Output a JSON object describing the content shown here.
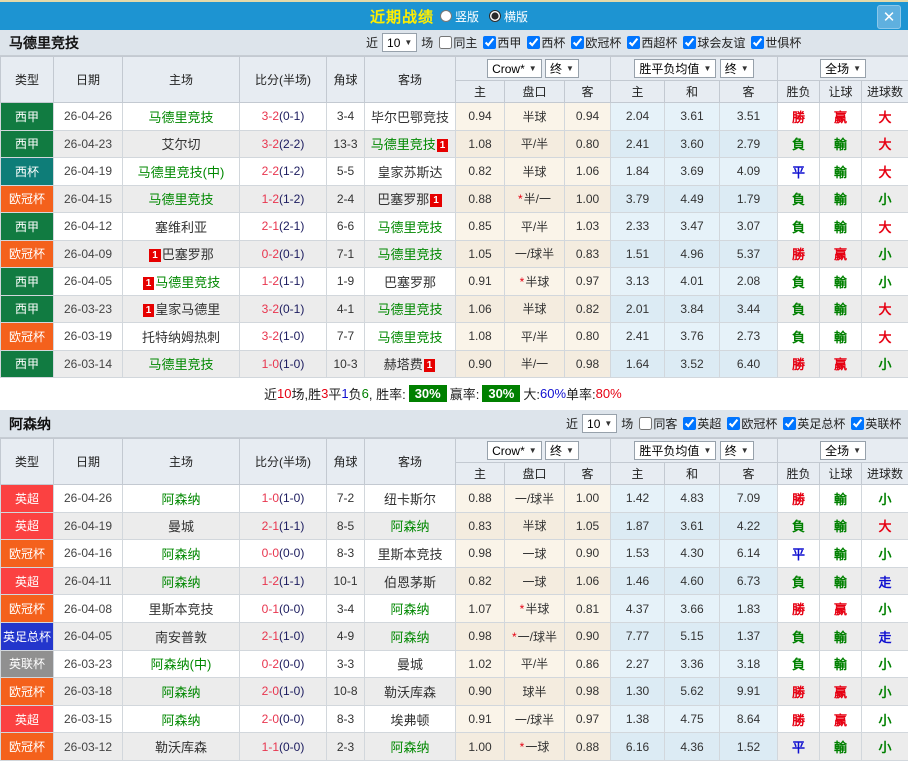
{
  "topbar": {
    "title": "近期战绩",
    "radios": [
      {
        "label": "竖版",
        "selected": false
      },
      {
        "label": "横版",
        "selected": true
      }
    ],
    "close_icon": "✕",
    "bar_color": "#1d94d2"
  },
  "dropdown_arrow": "▼",
  "table_header": {
    "cols": [
      "类型",
      "日期",
      "主场",
      "比分(半场)",
      "角球",
      "客场"
    ],
    "dropdowns": {
      "odds": "Crow*",
      "odds_final": "终",
      "avg": "胜平负均值",
      "avg_final": "终",
      "fullmatch": "全场"
    },
    "sub": [
      "主",
      "盘口",
      "客",
      "主",
      "和",
      "客",
      "胜负",
      "让球",
      "进球数"
    ]
  },
  "result_colors": {
    "勝": "#e60012",
    "負": "#008000",
    "平": "#1010d0",
    "赢": "#e60012",
    "輸": "#008000",
    "大": "#e60012",
    "小": "#008000",
    "走": "#1010d0"
  },
  "sections": [
    {
      "team": "马德里竞技",
      "filters": {
        "near_label": "近",
        "count": "10",
        "games_label": "场",
        "checkboxes": [
          {
            "label": "同主",
            "checked": false
          },
          {
            "label": "西甲",
            "checked": true
          },
          {
            "label": "西杯",
            "checked": true
          },
          {
            "label": "欧冠杯",
            "checked": true
          },
          {
            "label": "西超杯",
            "checked": true
          },
          {
            "label": "球会友谊",
            "checked": true
          },
          {
            "label": "世俱杯",
            "checked": true
          }
        ]
      },
      "rows": [
        {
          "type": "西甲",
          "type_color": "#117b41",
          "date": "26-04-26",
          "home": "马德里竞技",
          "home_green": true,
          "home_badge": false,
          "score": "3-2",
          "half": "(0-1)",
          "corner": "3-4",
          "away": "毕尔巴鄂竞技",
          "away_green": false,
          "away_badge": false,
          "o1": "0.94",
          "pan": "半球",
          "pan_star": false,
          "o2": "0.94",
          "m1": "2.04",
          "m2": "3.61",
          "m3": "3.51",
          "r1": "勝",
          "r2": "赢",
          "r3": "大"
        },
        {
          "type": "西甲",
          "type_color": "#117b41",
          "date": "26-04-23",
          "home": "艾尔切",
          "home_green": false,
          "home_badge": false,
          "score": "3-2",
          "half": "(2-2)",
          "corner": "13-3",
          "away": "马德里竞技",
          "away_green": true,
          "away_badge": true,
          "o1": "1.08",
          "pan": "平/半",
          "pan_star": false,
          "o2": "0.80",
          "m1": "2.41",
          "m2": "3.60",
          "m3": "2.79",
          "r1": "負",
          "r2": "輸",
          "r3": "大"
        },
        {
          "type": "西杯",
          "type_color": "#0e7d78",
          "date": "26-04-19",
          "home": "马德里竞技(中)",
          "home_green": true,
          "home_badge": false,
          "score": "2-2",
          "half": "(1-2)",
          "corner": "5-5",
          "away": "皇家苏斯达",
          "away_green": false,
          "away_badge": false,
          "o1": "0.82",
          "pan": "半球",
          "pan_star": false,
          "o2": "1.06",
          "m1": "1.84",
          "m2": "3.69",
          "m3": "4.09",
          "r1": "平",
          "r2": "輸",
          "r3": "大"
        },
        {
          "type": "欧冠杯",
          "type_color": "#f4611c",
          "date": "26-04-15",
          "home": "马德里竞技",
          "home_green": true,
          "home_badge": false,
          "score": "1-2",
          "half": "(1-2)",
          "corner": "2-4",
          "away": "巴塞罗那",
          "away_green": false,
          "away_badge": true,
          "o1": "0.88",
          "pan": "半/一",
          "pan_star": true,
          "o2": "1.00",
          "m1": "3.79",
          "m2": "4.49",
          "m3": "1.79",
          "r1": "負",
          "r2": "輸",
          "r3": "小"
        },
        {
          "type": "西甲",
          "type_color": "#117b41",
          "date": "26-04-12",
          "home": "塞维利亚",
          "home_green": false,
          "home_badge": false,
          "score": "2-1",
          "half": "(2-1)",
          "corner": "6-6",
          "away": "马德里竞技",
          "away_green": true,
          "away_badge": false,
          "o1": "0.85",
          "pan": "平/半",
          "pan_star": false,
          "o2": "1.03",
          "m1": "2.33",
          "m2": "3.47",
          "m3": "3.07",
          "r1": "負",
          "r2": "輸",
          "r3": "大"
        },
        {
          "type": "欧冠杯",
          "type_color": "#f4611c",
          "date": "26-04-09",
          "home": "巴塞罗那",
          "home_green": false,
          "home_badge": true,
          "score": "0-2",
          "half": "(0-1)",
          "corner": "7-1",
          "away": "马德里竞技",
          "away_green": true,
          "away_badge": false,
          "o1": "1.05",
          "pan": "一/球半",
          "pan_star": false,
          "o2": "0.83",
          "m1": "1.51",
          "m2": "4.96",
          "m3": "5.37",
          "r1": "勝",
          "r2": "赢",
          "r3": "小"
        },
        {
          "type": "西甲",
          "type_color": "#117b41",
          "date": "26-04-05",
          "home": "马德里竞技",
          "home_green": true,
          "home_badge": true,
          "score": "1-2",
          "half": "(1-1)",
          "corner": "1-9",
          "away": "巴塞罗那",
          "away_green": false,
          "away_badge": false,
          "o1": "0.91",
          "pan": "半球",
          "pan_star": true,
          "o2": "0.97",
          "m1": "3.13",
          "m2": "4.01",
          "m3": "2.08",
          "r1": "負",
          "r2": "輸",
          "r3": "小"
        },
        {
          "type": "西甲",
          "type_color": "#117b41",
          "date": "26-03-23",
          "home": "皇家马德里",
          "home_green": false,
          "home_badge": true,
          "score": "3-2",
          "half": "(0-1)",
          "corner": "4-1",
          "away": "马德里竞技",
          "away_green": true,
          "away_badge": false,
          "o1": "1.06",
          "pan": "半球",
          "pan_star": false,
          "o2": "0.82",
          "m1": "2.01",
          "m2": "3.84",
          "m3": "3.44",
          "r1": "負",
          "r2": "輸",
          "r3": "大"
        },
        {
          "type": "欧冠杯",
          "type_color": "#f4611c",
          "date": "26-03-19",
          "home": "托特纳姆热刺",
          "home_green": false,
          "home_badge": false,
          "score": "3-2",
          "half": "(1-0)",
          "corner": "7-7",
          "away": "马德里竞技",
          "away_green": true,
          "away_badge": false,
          "o1": "1.08",
          "pan": "平/半",
          "pan_star": false,
          "o2": "0.80",
          "m1": "2.41",
          "m2": "3.76",
          "m3": "2.73",
          "r1": "負",
          "r2": "輸",
          "r3": "大"
        },
        {
          "type": "西甲",
          "type_color": "#117b41",
          "date": "26-03-14",
          "home": "马德里竞技",
          "home_green": true,
          "home_badge": false,
          "score": "1-0",
          "half": "(1-0)",
          "corner": "10-3",
          "away": "赫塔费",
          "away_green": false,
          "away_badge": true,
          "o1": "0.90",
          "pan": "半/一",
          "pan_star": false,
          "o2": "0.98",
          "m1": "1.64",
          "m2": "3.52",
          "m3": "6.40",
          "r1": "勝",
          "r2": "赢",
          "r3": "小"
        }
      ],
      "summary": [
        {
          "t": "近"
        },
        {
          "t": "10",
          "c": "#e60012"
        },
        {
          "t": "场,胜"
        },
        {
          "t": "3",
          "c": "#e60012"
        },
        {
          "t": "平"
        },
        {
          "t": "1",
          "c": "#1010d0"
        },
        {
          "t": "负"
        },
        {
          "t": "6",
          "c": "#008000"
        },
        {
          "t": ", 胜率:"
        },
        {
          "t": "30%",
          "b": true
        },
        {
          "t": " 赢率:"
        },
        {
          "t": "30%",
          "b": true
        },
        {
          "t": " 大:"
        },
        {
          "t": "60%",
          "c": "#1010d0"
        },
        {
          "t": " 单率:"
        },
        {
          "t": "80%",
          "c": "#e60012"
        }
      ]
    },
    {
      "team": "阿森纳",
      "filters": {
        "near_label": "近",
        "count": "10",
        "games_label": "场",
        "checkboxes": [
          {
            "label": "同客",
            "checked": false
          },
          {
            "label": "英超",
            "checked": true
          },
          {
            "label": "欧冠杯",
            "checked": true
          },
          {
            "label": "英足总杯",
            "checked": true
          },
          {
            "label": "英联杯",
            "checked": true
          }
        ]
      },
      "rows": [
        {
          "type": "英超",
          "type_color": "#fb4141",
          "date": "26-04-26",
          "home": "阿森纳",
          "home_green": true,
          "home_badge": false,
          "score": "1-0",
          "half": "(1-0)",
          "corner": "7-2",
          "away": "纽卡斯尔",
          "away_green": false,
          "away_badge": false,
          "o1": "0.88",
          "pan": "一/球半",
          "pan_star": false,
          "o2": "1.00",
          "m1": "1.42",
          "m2": "4.83",
          "m3": "7.09",
          "r1": "勝",
          "r2": "輸",
          "r3": "小"
        },
        {
          "type": "英超",
          "type_color": "#fb4141",
          "date": "26-04-19",
          "home": "曼城",
          "home_green": false,
          "home_badge": false,
          "score": "2-1",
          "half": "(1-1)",
          "corner": "8-5",
          "away": "阿森纳",
          "away_green": true,
          "away_badge": false,
          "o1": "0.83",
          "pan": "半球",
          "pan_star": false,
          "o2": "1.05",
          "m1": "1.87",
          "m2": "3.61",
          "m3": "4.22",
          "r1": "負",
          "r2": "輸",
          "r3": "大"
        },
        {
          "type": "欧冠杯",
          "type_color": "#f4611c",
          "date": "26-04-16",
          "home": "阿森纳",
          "home_green": true,
          "home_badge": false,
          "score": "0-0",
          "half": "(0-0)",
          "corner": "8-3",
          "away": "里斯本竞技",
          "away_green": false,
          "away_badge": false,
          "o1": "0.98",
          "pan": "一球",
          "pan_star": false,
          "o2": "0.90",
          "m1": "1.53",
          "m2": "4.30",
          "m3": "6.14",
          "r1": "平",
          "r2": "輸",
          "r3": "小"
        },
        {
          "type": "英超",
          "type_color": "#fb4141",
          "date": "26-04-11",
          "home": "阿森纳",
          "home_green": true,
          "home_badge": false,
          "score": "1-2",
          "half": "(1-1)",
          "corner": "10-1",
          "away": "伯恩茅斯",
          "away_green": false,
          "away_badge": false,
          "o1": "0.82",
          "pan": "一球",
          "pan_star": false,
          "o2": "1.06",
          "m1": "1.46",
          "m2": "4.60",
          "m3": "6.73",
          "r1": "負",
          "r2": "輸",
          "r3": "走"
        },
        {
          "type": "欧冠杯",
          "type_color": "#f4611c",
          "date": "26-04-08",
          "home": "里斯本竞技",
          "home_green": false,
          "home_badge": false,
          "score": "0-1",
          "half": "(0-0)",
          "corner": "3-4",
          "away": "阿森纳",
          "away_green": true,
          "away_badge": false,
          "o1": "1.07",
          "pan": "半球",
          "pan_star": true,
          "o2": "0.81",
          "m1": "4.37",
          "m2": "3.66",
          "m3": "1.83",
          "r1": "勝",
          "r2": "赢",
          "r3": "小"
        },
        {
          "type": "英足总杯",
          "type_color": "#2336cc",
          "date": "26-04-05",
          "home": "南安普敦",
          "home_green": false,
          "home_badge": false,
          "score": "2-1",
          "half": "(1-0)",
          "corner": "4-9",
          "away": "阿森纳",
          "away_green": true,
          "away_badge": false,
          "o1": "0.98",
          "pan": "一/球半",
          "pan_star": true,
          "o2": "0.90",
          "m1": "7.77",
          "m2": "5.15",
          "m3": "1.37",
          "r1": "負",
          "r2": "輸",
          "r3": "走"
        },
        {
          "type": "英联杯",
          "type_color": "#909090",
          "date": "26-03-23",
          "home": "阿森纳(中)",
          "home_green": true,
          "home_badge": false,
          "score": "0-2",
          "half": "(0-0)",
          "corner": "3-3",
          "away": "曼城",
          "away_green": false,
          "away_badge": false,
          "o1": "1.02",
          "pan": "平/半",
          "pan_star": false,
          "o2": "0.86",
          "m1": "2.27",
          "m2": "3.36",
          "m3": "3.18",
          "r1": "負",
          "r2": "輸",
          "r3": "小"
        },
        {
          "type": "欧冠杯",
          "type_color": "#f4611c",
          "date": "26-03-18",
          "home": "阿森纳",
          "home_green": true,
          "home_badge": false,
          "score": "2-0",
          "half": "(1-0)",
          "corner": "10-8",
          "away": "勒沃库森",
          "away_green": false,
          "away_badge": false,
          "o1": "0.90",
          "pan": "球半",
          "pan_star": false,
          "o2": "0.98",
          "m1": "1.30",
          "m2": "5.62",
          "m3": "9.91",
          "r1": "勝",
          "r2": "赢",
          "r3": "小"
        },
        {
          "type": "英超",
          "type_color": "#fb4141",
          "date": "26-03-15",
          "home": "阿森纳",
          "home_green": true,
          "home_badge": false,
          "score": "2-0",
          "half": "(0-0)",
          "corner": "8-3",
          "away": "埃弗顿",
          "away_green": false,
          "away_badge": false,
          "o1": "0.91",
          "pan": "一/球半",
          "pan_star": false,
          "o2": "0.97",
          "m1": "1.38",
          "m2": "4.75",
          "m3": "8.64",
          "r1": "勝",
          "r2": "赢",
          "r3": "小"
        },
        {
          "type": "欧冠杯",
          "type_color": "#f4611c",
          "date": "26-03-12",
          "home": "勒沃库森",
          "home_green": false,
          "home_badge": false,
          "score": "1-1",
          "half": "(0-0)",
          "corner": "2-3",
          "away": "阿森纳",
          "away_green": true,
          "away_badge": false,
          "o1": "1.00",
          "pan": "一球",
          "pan_star": true,
          "o2": "0.88",
          "m1": "6.16",
          "m2": "4.36",
          "m3": "1.52",
          "r1": "平",
          "r2": "輸",
          "r3": "小"
        }
      ],
      "summary": []
    }
  ]
}
